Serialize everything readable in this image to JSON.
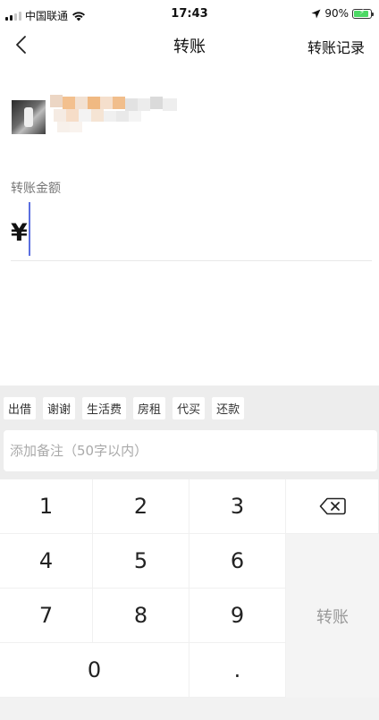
{
  "status_bar": {
    "carrier": "中国联通",
    "time": "17:43",
    "battery_percent": "90%",
    "battery_level": 0.9,
    "battery_color": "#4cd964"
  },
  "nav": {
    "back_icon": "chevron-left-icon",
    "title": "转账",
    "history_label": "转账记录"
  },
  "recipient": {
    "avatar_icon": "avatar-image"
  },
  "amount": {
    "label": "转账金额",
    "currency_symbol": "¥",
    "value": ""
  },
  "quick_tags": [
    "出借",
    "谢谢",
    "生活费",
    "房租",
    "代买",
    "还款"
  ],
  "remark": {
    "placeholder": "添加备注（50字以内）",
    "value": ""
  },
  "keypad": {
    "keys": [
      "1",
      "2",
      "3",
      "4",
      "5",
      "6",
      "7",
      "8",
      "9",
      "0",
      "."
    ],
    "delete_icon": "backspace-icon",
    "submit_label": "转账"
  },
  "colors": {
    "caret": "#5b6fe0",
    "panel_bg": "#ededed"
  }
}
